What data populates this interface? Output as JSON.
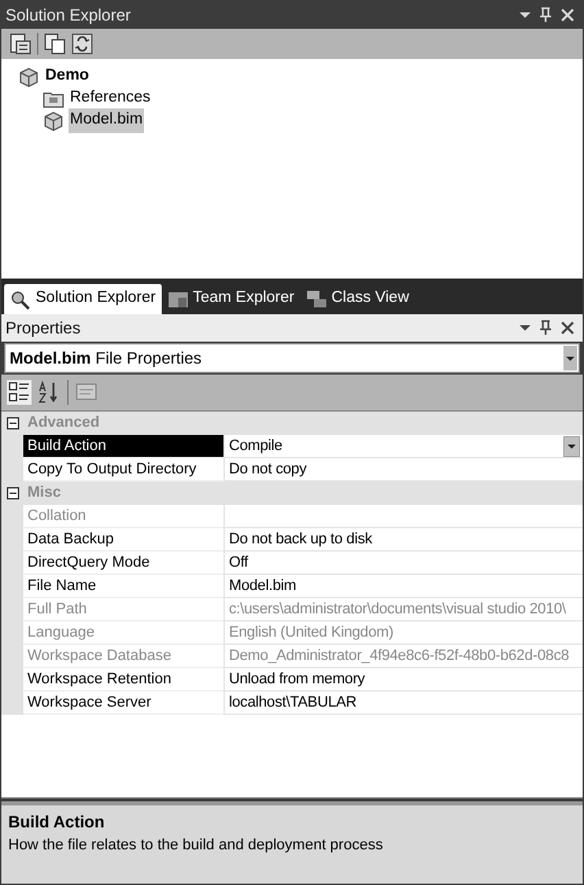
{
  "solution_explorer": {
    "title": "Solution Explorer",
    "tree": [
      {
        "label": "Demo",
        "bold": true,
        "selected": false,
        "children": [
          {
            "label": "References",
            "bold": false,
            "selected": false
          },
          {
            "label": "Model.bim",
            "bold": false,
            "selected": true
          }
        ]
      }
    ],
    "tabs": [
      {
        "label": "Solution Explorer",
        "selected": true
      },
      {
        "label": "Team Explorer",
        "selected": false
      },
      {
        "label": "Class View",
        "selected": false
      }
    ]
  },
  "properties": {
    "title": "Properties",
    "object": {
      "name": "Model.bim",
      "type": "File Properties"
    },
    "categories": [
      {
        "name": "Advanced",
        "expanded": true,
        "rows": [
          {
            "name": "Build Action",
            "value": "Compile",
            "disabled": false,
            "selected": true
          },
          {
            "name": "Copy To Output Directory",
            "value": "Do not copy",
            "disabled": false,
            "selected": false
          }
        ]
      },
      {
        "name": "Misc",
        "expanded": true,
        "rows": [
          {
            "name": "Collation",
            "disabled": true,
            "selected": false
          },
          {
            "name": "Data Backup",
            "value": "Do not back up to disk",
            "disabled": false,
            "selected": false
          },
          {
            "name": "DirectQuery Mode",
            "value": "Off",
            "disabled": false,
            "selected": false
          },
          {
            "name": "File Name",
            "value": "Model.bim",
            "disabled": false,
            "selected": false
          },
          {
            "name": "Full Path",
            "value": "c:\\users\\administrator\\documents\\visual studio 2010\\",
            "disabled": true,
            "selected": false
          },
          {
            "name": "Language",
            "value": "English (United Kingdom)",
            "disabled": true,
            "selected": false
          },
          {
            "name": "Workspace Database",
            "value": "Demo_Administrator_4f94e8c6-f52f-48b0-b62d-08c8",
            "disabled": true,
            "selected": false
          },
          {
            "name": "Workspace Retention",
            "value": "Unload from memory",
            "disabled": false,
            "selected": false
          },
          {
            "name": "Workspace Server",
            "value": "localhost\\TABULAR",
            "disabled": false,
            "selected": false
          }
        ]
      }
    ],
    "description": {
      "title": "Build Action",
      "text": "How the file relates to the build and deployment process"
    }
  }
}
